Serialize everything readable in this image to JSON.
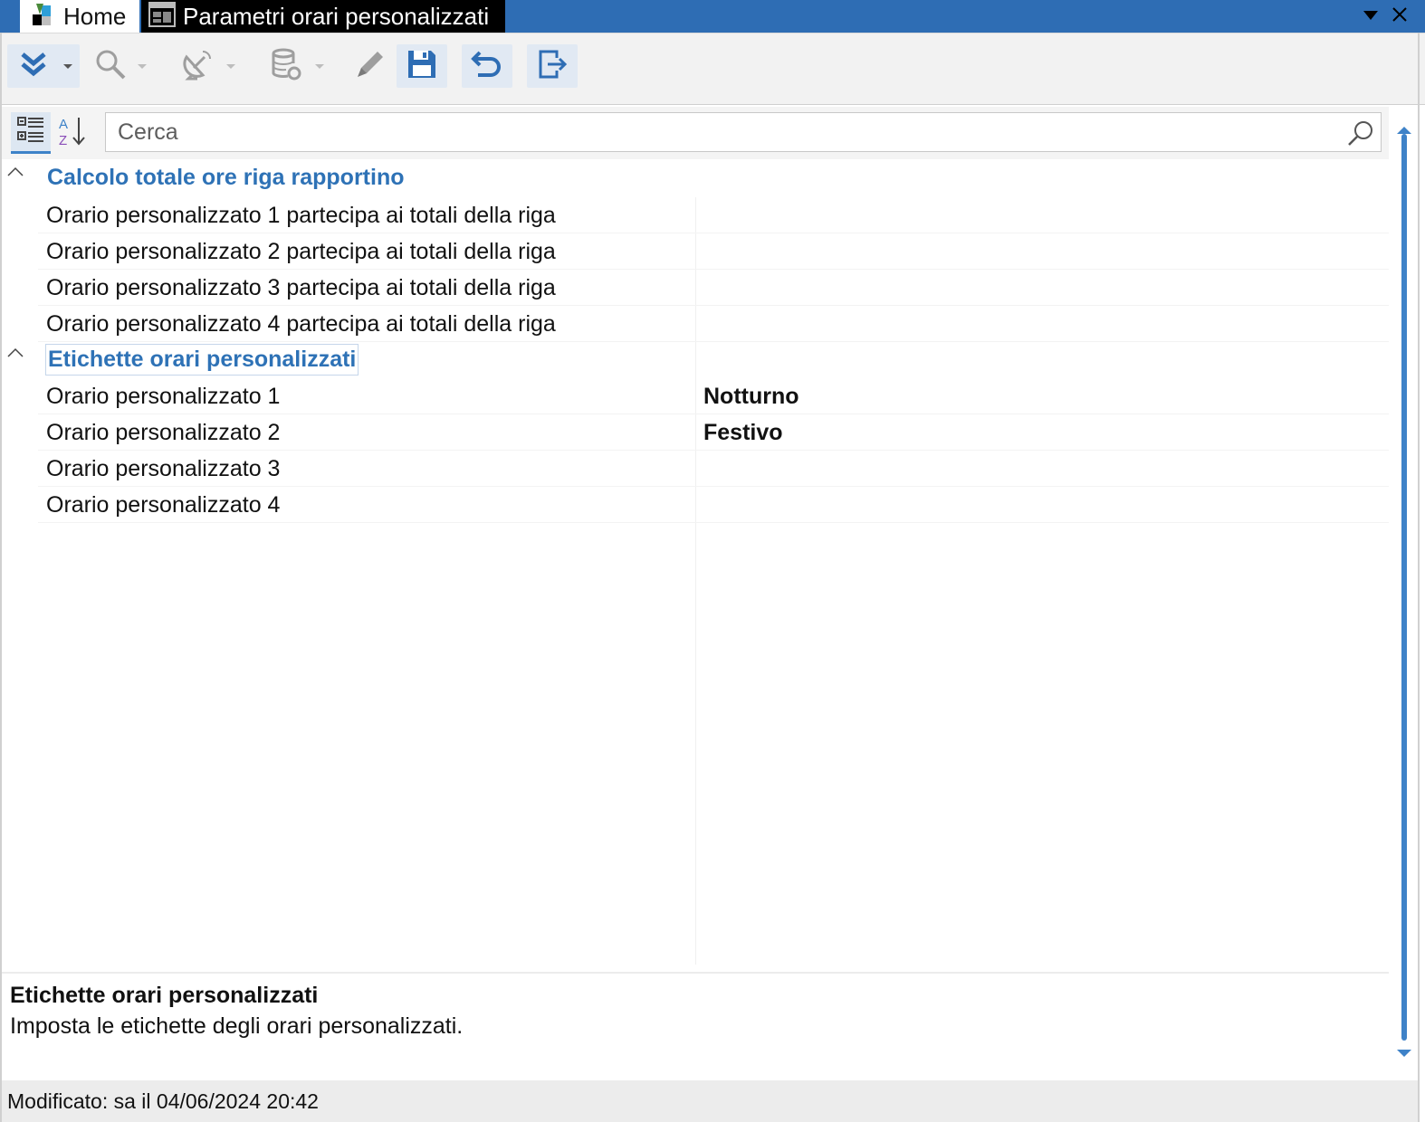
{
  "window": {
    "tabs": [
      {
        "label": "Home"
      },
      {
        "label": "Parametri orari personalizzati"
      }
    ],
    "colors": {
      "titlebar": "#2e6db4",
      "accent": "#2e72b6"
    }
  },
  "toolbar": {
    "buttons": [
      {
        "icon": "double-chevron-down-icon",
        "has_dropdown": true
      },
      {
        "icon": "search-icon",
        "has_dropdown": true
      },
      {
        "icon": "satellite-dish-icon",
        "has_dropdown": true
      },
      {
        "icon": "database-icon",
        "has_dropdown": true
      },
      {
        "icon": "pencil-icon"
      },
      {
        "icon": "save-icon"
      },
      {
        "icon": "undo-icon"
      },
      {
        "icon": "exit-icon"
      }
    ]
  },
  "search": {
    "placeholder": "Cerca"
  },
  "categories": [
    {
      "title": "Calcolo totale ore riga rapportino",
      "expanded": true,
      "rows": [
        {
          "name": "Orario personalizzato 1 partecipa ai totali della riga",
          "value": ""
        },
        {
          "name": "Orario personalizzato 2 partecipa ai totali della riga",
          "value": ""
        },
        {
          "name": "Orario personalizzato 3 partecipa ai totali della riga",
          "value": ""
        },
        {
          "name": "Orario personalizzato 4 partecipa ai totali della riga",
          "value": ""
        }
      ]
    },
    {
      "title": "Etichette orari personalizzati",
      "expanded": true,
      "rows": [
        {
          "name": "Orario personalizzato 1",
          "value": "Notturno"
        },
        {
          "name": "Orario personalizzato 2",
          "value": "Festivo"
        },
        {
          "name": "Orario personalizzato 3",
          "value": ""
        },
        {
          "name": "Orario personalizzato 4",
          "value": ""
        }
      ]
    }
  ],
  "description": {
    "title": "Etichette orari personalizzati",
    "text": "Imposta le etichette degli orari personalizzati."
  },
  "status": {
    "text": "Modificato: sa il 04/06/2024 20:42"
  }
}
